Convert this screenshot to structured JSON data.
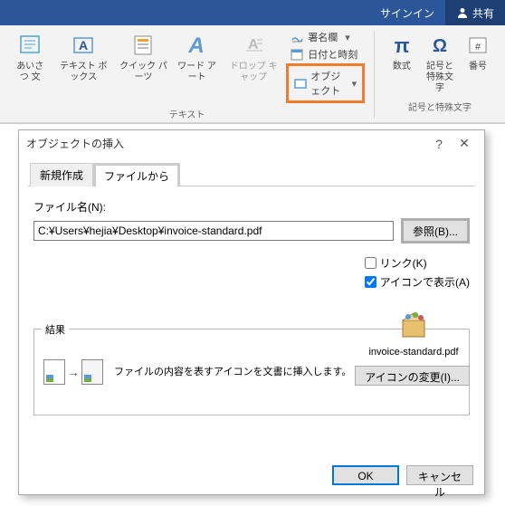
{
  "titlebar": {
    "signin": "サインイン",
    "share": "共有"
  },
  "ribbon": {
    "greeting": "あいさつ\n文",
    "textbox": "テキスト\nボックス",
    "quickparts": "クイック パーツ",
    "wordart": "ワード\nアート",
    "dropcap": "ドロップ\nキャップ",
    "signature": "署名欄",
    "datetime": "日付と時刻",
    "object": "オブジェクト",
    "equation": "数式",
    "symbol": "記号と\n特殊文字",
    "number": "番号",
    "group_text": "テキスト",
    "group_symbol": "記号と特殊文字"
  },
  "dialog": {
    "title": "オブジェクトの挿入",
    "tab_new": "新規作成",
    "tab_file": "ファイルから",
    "filename_label": "ファイル名(N):",
    "filename_value": "C:¥Users¥hejia¥Desktop¥invoice-standard.pdf",
    "browse": "参照(B)...",
    "link": "リンク(K)",
    "show_as_icon": "アイコンで表示(A)",
    "result_label": "結果",
    "result_text": "ファイルの内容を表すアイコンを文書に挿入します。",
    "preview_name": "invoice-standard.pdf",
    "change_icon": "アイコンの変更(I)...",
    "ok": "OK",
    "cancel": "キャンセル"
  }
}
